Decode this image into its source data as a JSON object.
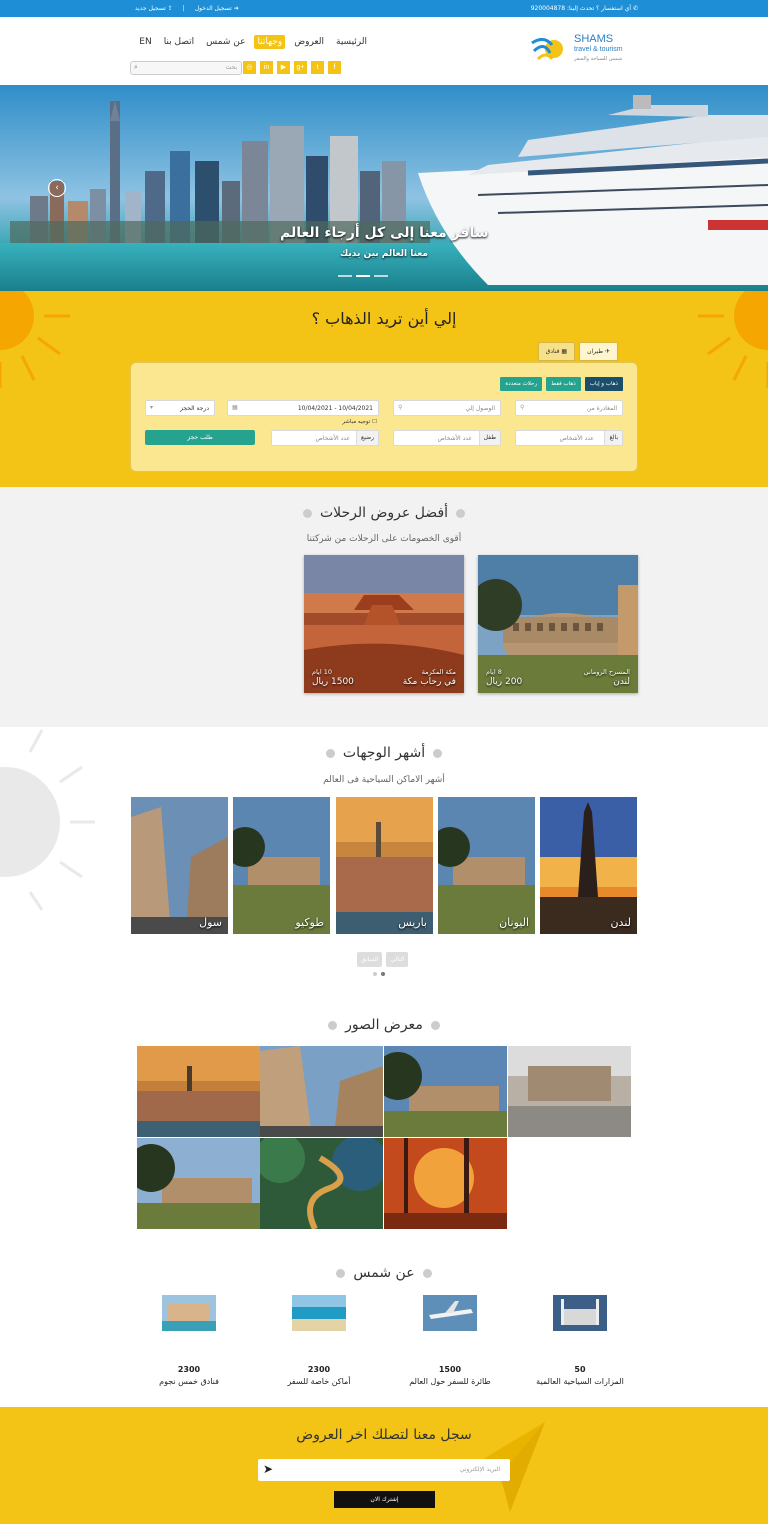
{
  "topbar": {
    "phone": "✆ أي استفسار ؟ تحدث إلينا: 920004878",
    "login": "➔ تسجيل الدخول",
    "register": "⇪ تسجيل جديد",
    "separator": "|"
  },
  "logo": {
    "name": "SHAMS",
    "tagline": "travel & tourism",
    "arabic": "شمس للسياحة والسفر"
  },
  "nav": {
    "items": [
      {
        "label": "الرئيسية",
        "active": false
      },
      {
        "label": "العروض",
        "active": false
      },
      {
        "label": "وجهاتنا",
        "active": true
      },
      {
        "label": "عن شمس",
        "active": false
      },
      {
        "label": "اتصل بنا",
        "active": false
      },
      {
        "label": "EN",
        "active": false
      }
    ],
    "socials": [
      "f",
      "t",
      "g+",
      "▶",
      "in",
      "◎"
    ],
    "search_placeholder": "بحث"
  },
  "hero": {
    "headline": "سافر معنا إلى كل أرجاء العالم",
    "subline": "معنا العالم بين يديك"
  },
  "search": {
    "title": "إلي أين تريد الذهاب ؟",
    "tabs": [
      {
        "label": "✈ طيران",
        "active": true
      },
      {
        "label": "▦ فنادق",
        "active": false
      }
    ],
    "trip_types": [
      {
        "label": "ذهاب و إياب",
        "active": true
      },
      {
        "label": "ذهاب فقط",
        "active": false
      },
      {
        "label": "رحلات متعددة",
        "active": false
      }
    ],
    "from_placeholder": "المغادرة من",
    "to_placeholder": "الوصول إلي",
    "date_value": "10/04/2021 - 10/04/2021",
    "class_label": "درجة الحجز",
    "direct_label": "توجيه مباشر",
    "adults_prefix": "بالغ",
    "children_prefix": "طفل",
    "infants_prefix": "رضيع",
    "count_placeholder": "عدد الأشخاص",
    "book_button": "طلب حجز"
  },
  "offers": {
    "title": "أفضل عروض الرحلات",
    "subtitle": "أقوى الخصومات على الرحلات من شركتنا",
    "cards": [
      {
        "place": "المسرح الروماني",
        "city": "لندن",
        "duration": "8 ايام",
        "price": "200 ريال"
      },
      {
        "place": "مكة المكرمة",
        "city": "في رحاب مكة",
        "duration": "10 ايام",
        "price": "1500 ريال"
      }
    ]
  },
  "destinations": {
    "title": "أشهر الوجهات",
    "subtitle": "أشهر الاماكن السياحية فى العالم",
    "cards": [
      "لندن",
      "اليونان",
      "باريس",
      "طوكيو",
      "سول"
    ],
    "pager": [
      "السابق",
      "التالي"
    ]
  },
  "gallery": {
    "title": "معرض الصور"
  },
  "about": {
    "title": "عن شمس",
    "stats": [
      {
        "num": "50",
        "text": "المزارات السياحية العالمية"
      },
      {
        "num": "1500",
        "text": "طائرة للسفر حول العالم"
      },
      {
        "num": "2300",
        "text": "أماكن خاصة للسفر"
      },
      {
        "num": "2300",
        "text": "فنادق خمس نجوم"
      }
    ]
  },
  "newsletter": {
    "title": "سجل معنا لتصلك اخر العروض",
    "email_placeholder": "البريد الإلكتروني",
    "subscribe": "إشترك الان"
  },
  "colors": {
    "accent": "#f3c316",
    "topbar": "#1e8fd6",
    "teal": "#26a38f",
    "navy": "#1b4e6b"
  }
}
